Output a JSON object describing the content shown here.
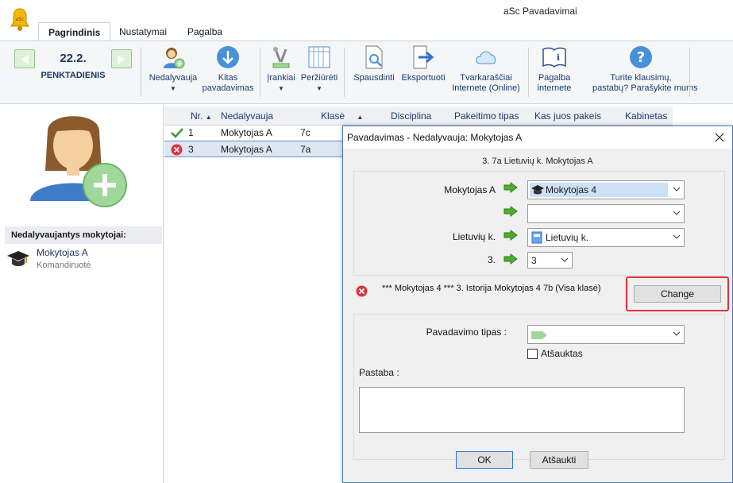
{
  "app": {
    "title": "aSc Pavadavimai"
  },
  "ribbon": {
    "tabs": [
      "Pagrindinis",
      "Nustatymai",
      "Pagalba"
    ],
    "date": "22.2.",
    "weekday": "PENKTADIENIS",
    "buttons": {
      "absent": [
        "Nedalyvauja"
      ],
      "next": [
        "Kitas",
        "pavadavimas"
      ],
      "tools": [
        "Įrankiai"
      ],
      "view": [
        "Peržiūrėti"
      ],
      "print": [
        "Spausdinti"
      ],
      "export": [
        "Eksportuoti"
      ],
      "online": [
        "Tvarkaraščiai",
        "Internete (Online)"
      ],
      "help": [
        "Pagalba",
        "internete"
      ],
      "questions": [
        "Turite klausimų,",
        "pastabų? Parašykite mums"
      ]
    }
  },
  "left_panel": {
    "header": "Nedalyvaujantys mokytojai:",
    "teacher_name": "Mokytojas A",
    "teacher_reason": "Komandiruotė"
  },
  "table": {
    "columns": [
      "Nr.",
      "Nedalyvauja",
      "Klasė",
      "Disciplina",
      "Pakeitimo tipas",
      "Kas juos pakeis",
      "Kabinetas"
    ],
    "rows": [
      {
        "status": "ok",
        "nr": "1",
        "teacher": "Mokytojas A",
        "class": "7c"
      },
      {
        "status": "error",
        "nr": "3",
        "teacher": "Mokytojas A",
        "class": "7a"
      }
    ]
  },
  "dialog": {
    "title": "Pavadavimas - Nedalyvauja: Mokytojas A",
    "subtitle": "3.  7a  Lietuvių k.  Mokytojas A",
    "teacher_label": "Mokytojas A",
    "teacher_value": "Mokytojas 4",
    "second_value": "",
    "subject_label": "Lietuvių k.",
    "subject_value": "Lietuvių k.",
    "period_label": "3.",
    "period_value": "3",
    "conflict_text": "*** Mokytojas 4 *** 3. Istorija Mokytojas 4 7b (Visa klasė)",
    "change_button": "Change",
    "type_label": "Pavadavimo tipas :",
    "type_value": "",
    "cancelled_label": "Atšauktas",
    "note_label": "Pastaba :",
    "note_value": "",
    "ok_button": "OK",
    "cancel_button": "Atšaukti"
  },
  "colors": {
    "accent": "#1f3864",
    "error": "#e0313a",
    "ok": "#3a9d2a",
    "arrow": "#4caf30"
  }
}
